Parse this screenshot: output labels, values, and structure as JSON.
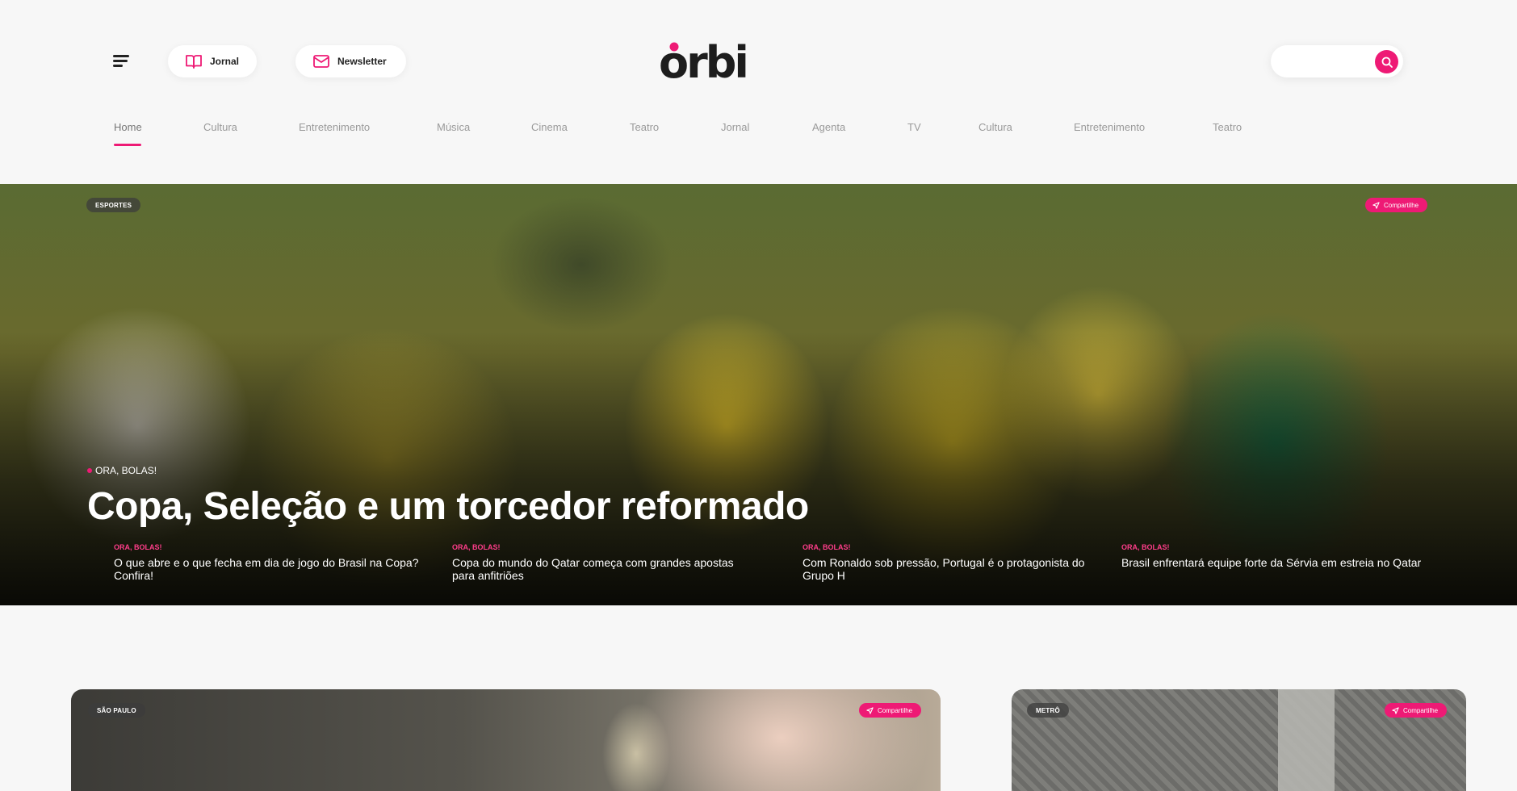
{
  "header": {
    "jornal_label": "Jornal",
    "newsletter_label": "Newsletter",
    "logo_text": "orbi",
    "search_placeholder": ""
  },
  "nav": {
    "items": [
      "Home",
      "Cultura",
      "Entretenimento",
      "Música",
      "Cinema",
      "Teatro",
      "Jornal",
      "Agenta",
      "TV",
      "Cultura",
      "Entretenimento",
      "Teatro"
    ],
    "active_index": 0
  },
  "hero": {
    "category": "ESPORTES",
    "share_label": "Compartilhe",
    "kicker": "ORA, BOLAS!",
    "title": "Copa, Seleção e um torcedor reformado",
    "related": [
      {
        "kicker": "ORA, BOLAS!",
        "headline": "O que abre e o que fecha em dia de jogo do Brasil na Copa? Confira!"
      },
      {
        "kicker": "ORA, BOLAS!",
        "headline": "Copa do mundo do Qatar começa com grandes apostas para anfitriões"
      },
      {
        "kicker": "ORA, BOLAS!",
        "headline": "Com Ronaldo sob pressão, Portugal é o protagonista do Grupo H"
      },
      {
        "kicker": "ORA, BOLAS!",
        "headline": "Brasil enfrentará equipe forte da Sérvia em estreia no Qatar"
      }
    ]
  },
  "cards": [
    {
      "category": "SÃO PAULO",
      "share_label": "Compartilhe"
    },
    {
      "category": "METRÔ",
      "share_label": "Compartilhe"
    }
  ],
  "colors": {
    "accent": "#ee1a75",
    "background": "#f7f7f7",
    "nav_text": "#9a9a9a"
  }
}
